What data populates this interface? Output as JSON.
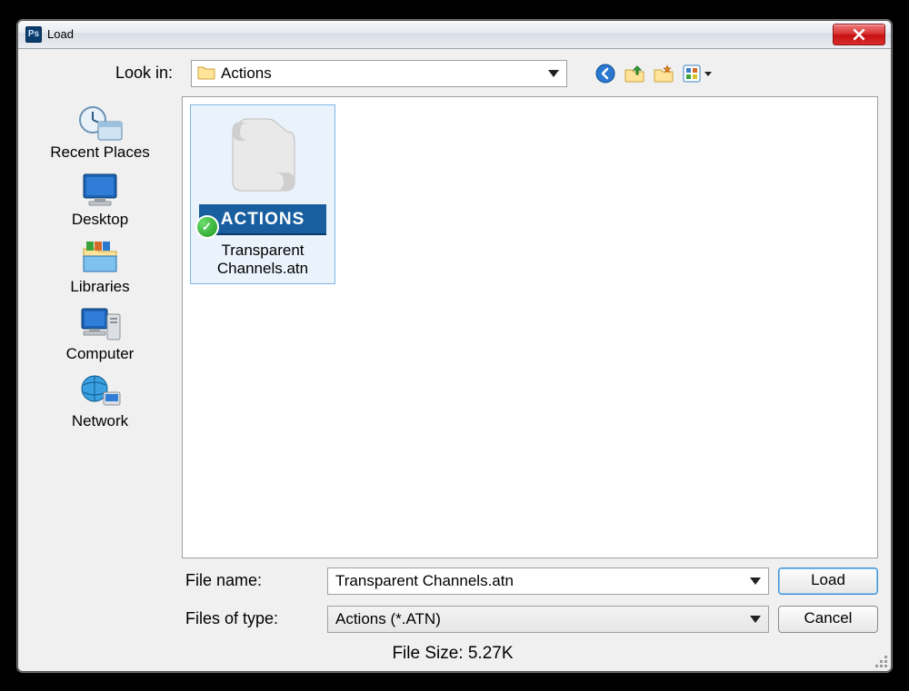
{
  "window": {
    "title": "Load"
  },
  "lookin": {
    "label": "Look in:",
    "value": "Actions"
  },
  "toolbar": {
    "back_icon": "back-icon",
    "up_icon": "folder-up-icon",
    "new_folder_icon": "new-folder-icon",
    "view_icon": "view-menu-icon"
  },
  "places": [
    {
      "label": "Recent Places",
      "icon": "recent"
    },
    {
      "label": "Desktop",
      "icon": "desktop"
    },
    {
      "label": "Libraries",
      "icon": "libraries"
    },
    {
      "label": "Computer",
      "icon": "computer"
    },
    {
      "label": "Network",
      "icon": "network"
    }
  ],
  "files": [
    {
      "label": "Transparent Channels.atn",
      "badge": "ACTIONS"
    }
  ],
  "filename": {
    "label": "File name:",
    "value": "Transparent Channels.atn"
  },
  "filetype": {
    "label": "Files of type:",
    "value": "Actions (*.ATN)"
  },
  "buttons": {
    "load": "Load",
    "cancel": "Cancel"
  },
  "filesize": "File Size: 5.27K"
}
